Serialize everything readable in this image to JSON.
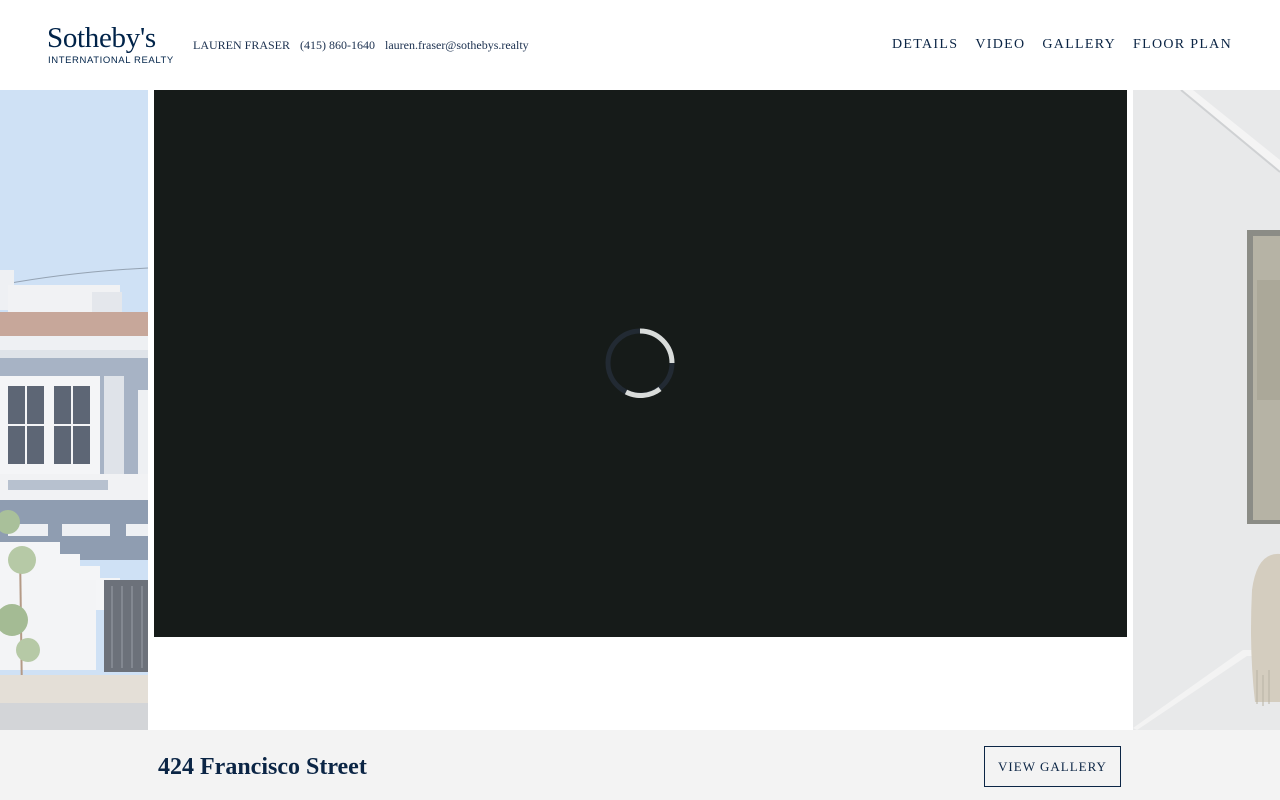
{
  "brand": {
    "logo_name": "Sotheby's",
    "logo_sub": "INTERNATIONAL REALTY"
  },
  "agent": {
    "name": "LAUREN FRASER",
    "phone": "(415) 860-1640",
    "email": "lauren.fraser@sothebys.realty"
  },
  "nav": {
    "items": [
      "DETAILS",
      "VIDEO",
      "GALLERY",
      "FLOOR PLAN"
    ]
  },
  "video": {
    "state": "loading",
    "spinner_color": "#d9dcda"
  },
  "listing": {
    "address": "424 Francisco Street",
    "gallery_button": "VIEW GALLERY"
  },
  "colors": {
    "brand_navy": "#002349",
    "video_bg": "#161b19",
    "bottom_bar_bg": "#f3f3f3"
  }
}
